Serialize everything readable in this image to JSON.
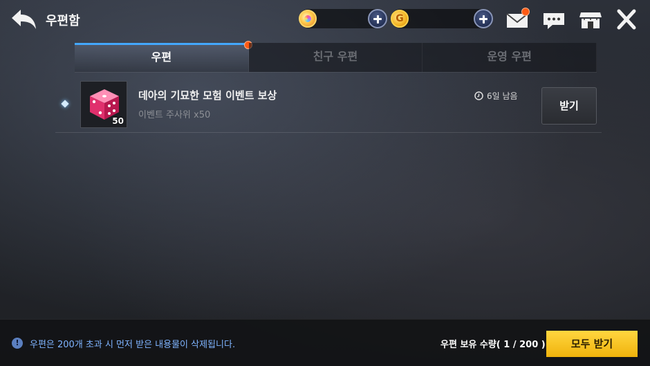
{
  "header": {
    "title": "우편함",
    "back_icon": "back-arrow-icon",
    "currencies": [
      {
        "icon": "gem-coin-icon",
        "value": ""
      },
      {
        "icon": "gold-coin-icon",
        "glyph": "G",
        "value": ""
      }
    ],
    "icons": [
      "mail-icon",
      "chat-icon",
      "shop-icon",
      "close-icon"
    ]
  },
  "tabs": [
    {
      "label": "우편",
      "active": true,
      "has_badge": true
    },
    {
      "label": "친구 우편",
      "active": false
    },
    {
      "label": "운영 우편",
      "active": false
    }
  ],
  "mails": [
    {
      "title": "데아의 기묘한 모험 이벤트 보상",
      "subtitle": "이벤트 주사위 x50",
      "item_count": "50",
      "time_left": "6일 남음",
      "receive_label": "받기"
    }
  ],
  "footer": {
    "info_glyph": "!",
    "notice": "우편은 200개 초과 시 먼저 받은 내용물이 삭제됩니다.",
    "count_text": "우편 보유 수량( 1 / 200 )",
    "receive_all_label": "모두 받기"
  },
  "colors": {
    "accent_tab": "#43a8ff",
    "badge": "#ff5a14",
    "notice_text": "#7fb4ff",
    "receive_all_bg": "#f0b30c"
  }
}
